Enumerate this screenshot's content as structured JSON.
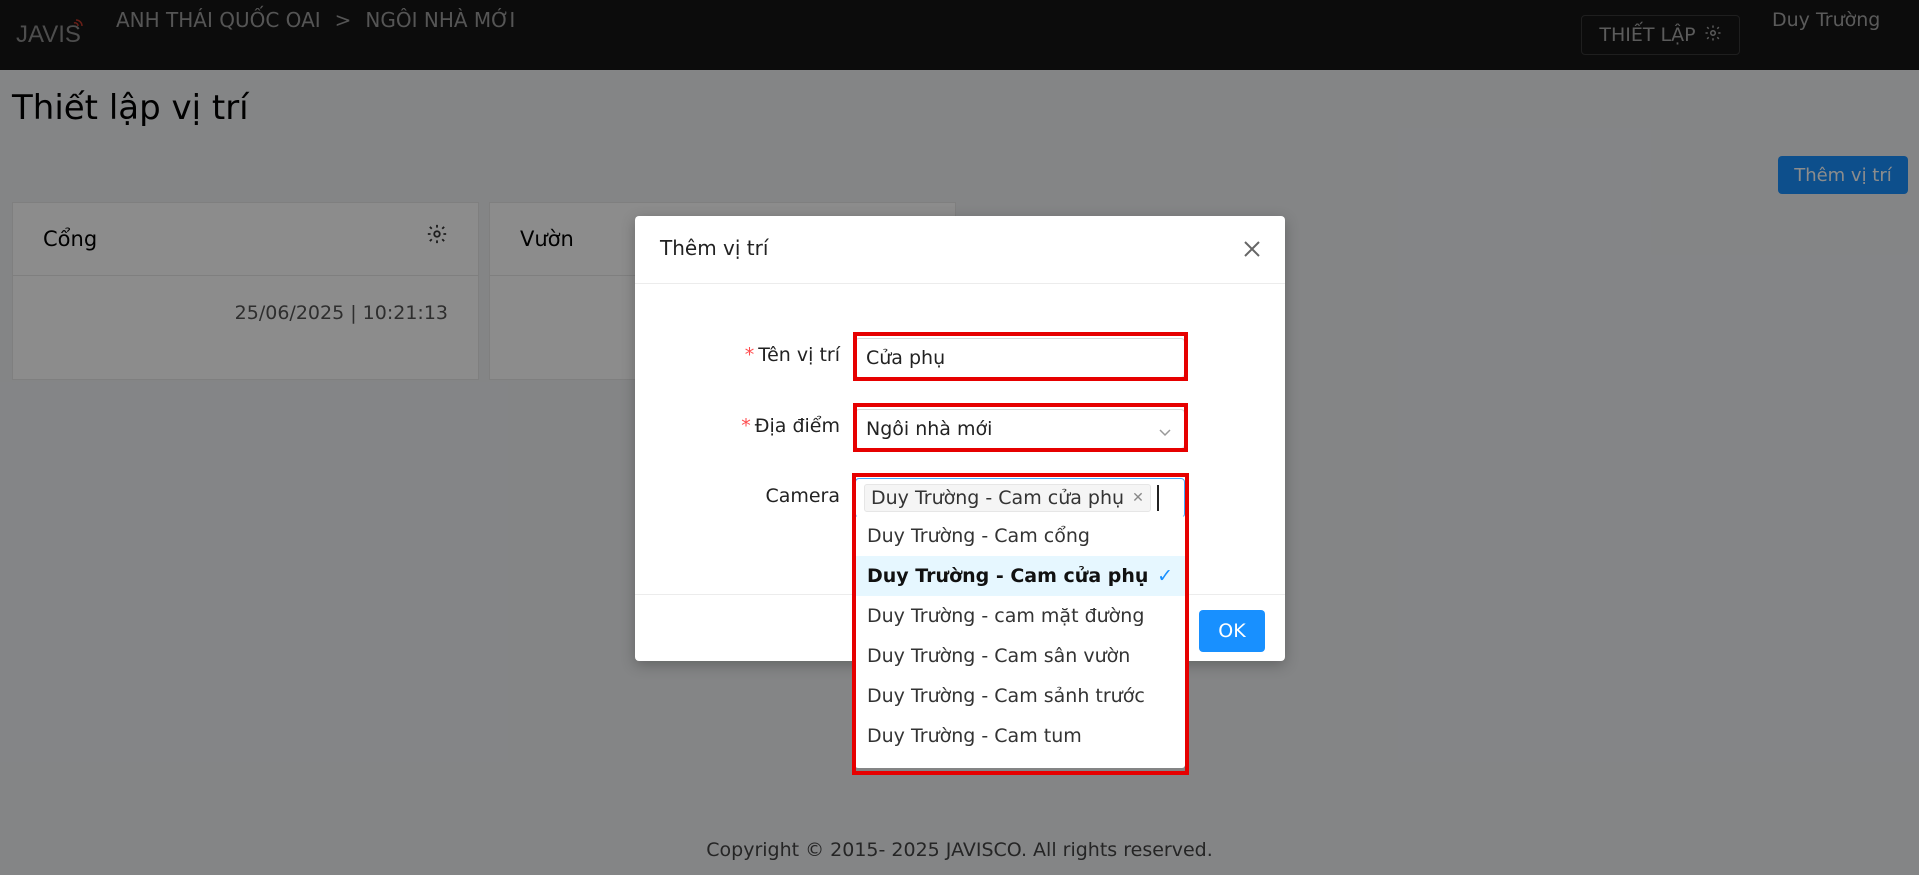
{
  "header": {
    "logo_text": "JAVIS",
    "breadcrumb": [
      "ANH THÁI QUỐC OAI",
      "NGÔI NHÀ MỚI"
    ],
    "settings_label": "THIẾT LẬP",
    "user_name": "Duy Trường"
  },
  "page": {
    "title": "Thiết lập vị trí",
    "add_button": "Thêm vị trí",
    "cards": [
      {
        "name": "Cổng",
        "timestamp": "25/06/2025 | 10:21:13"
      },
      {
        "name": "Vườn",
        "timestamp": ""
      }
    ]
  },
  "modal": {
    "title": "Thêm vị trí",
    "name_label": "Tên vị trí",
    "name_value": "Cửa phụ",
    "location_label": "Địa điểm",
    "location_value": "Ngôi nhà mới",
    "camera_label": "Camera",
    "camera_selected_tag": "Duy Trường - Cam cửa phụ",
    "ok_label": "OK"
  },
  "dropdown": {
    "options": [
      {
        "label": "Duy Trường - Cam cổng",
        "selected": false
      },
      {
        "label": "Duy Trường - Cam cửa phụ",
        "selected": true
      },
      {
        "label": "Duy Trường - cam mặt đường",
        "selected": false
      },
      {
        "label": "Duy Trường - Cam sân vườn",
        "selected": false
      },
      {
        "label": "Duy Trường - Cam sảnh trước",
        "selected": false
      },
      {
        "label": "Duy Trường - Cam tum",
        "selected": false
      }
    ]
  },
  "footer": {
    "copyright": "Copyright © 2015- 2025 JAVISCO. All rights reserved."
  },
  "colors": {
    "accent": "#1890ff",
    "highlight": "#e60000",
    "header_bg": "#161616"
  }
}
